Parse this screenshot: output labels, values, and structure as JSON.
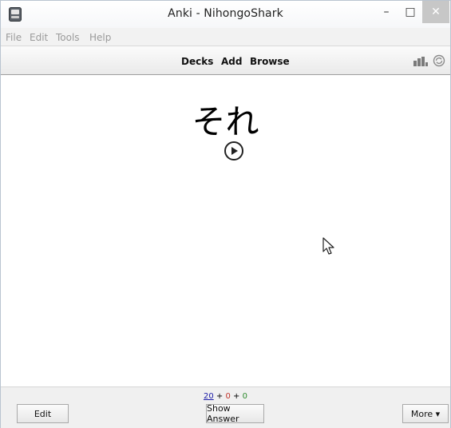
{
  "window": {
    "title": "Anki - NihongoShark"
  },
  "controls": {
    "minimize": "–",
    "maximize": "□",
    "close": "✕"
  },
  "menu": {
    "items": [
      "File",
      "Edit",
      "Tools",
      "Help"
    ]
  },
  "toolbar": {
    "links": [
      "Decks",
      "Add",
      "Browse"
    ]
  },
  "card": {
    "front": "それ"
  },
  "counts": {
    "new": "20",
    "plus1": "+",
    "learn": "0",
    "plus2": "+",
    "review": "0"
  },
  "buttons": {
    "edit": "Edit",
    "show_answer": "Show Answer",
    "more": "More ▾"
  },
  "colors": {
    "new": "#1a1aa6",
    "learn": "#c1352b",
    "review": "#2e8b2e"
  }
}
